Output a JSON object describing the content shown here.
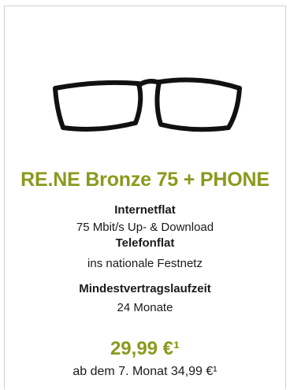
{
  "colors": {
    "accent": "#8a9a1c",
    "text": "#1a1a1a",
    "border": "#cfcfcf"
  },
  "product": {
    "icon": "glasses-icon",
    "title": "RE.NE Bronze 75 + PHONE",
    "features": [
      {
        "heading": "Internetflat",
        "detail": "75 Mbit/s  Up- & Download"
      },
      {
        "heading": "Telefonflat",
        "detail": "ins nationale Festnetz"
      },
      {
        "heading": "Mindestvertragslaufzeit",
        "detail": "24 Monate"
      }
    ],
    "price": "29,99 €¹",
    "price_after": "ab dem 7. Monat 34,99 €¹"
  }
}
